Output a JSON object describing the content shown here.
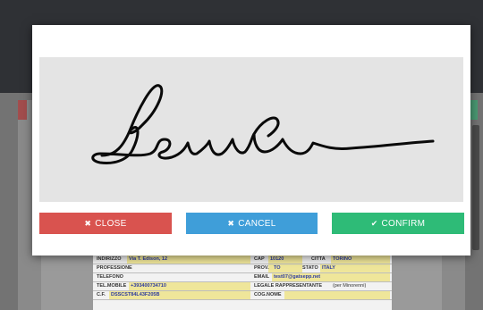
{
  "dialog": {
    "buttons": {
      "close_label": "CLOSE",
      "cancel_label": "CANCEL",
      "confirm_label": "CONFIRM"
    },
    "icons": {
      "close": "times-icon",
      "cancel": "times-icon",
      "confirm": "check-icon"
    },
    "colors": {
      "close": "#d9534f",
      "cancel": "#3f9ed9",
      "confirm": "#2ebb77",
      "canvas": "#e4e4e4"
    }
  },
  "form": {
    "row1": {
      "label": "INDIRIZZO",
      "value": "Via T. Edison, 12",
      "cap_label": "CAP",
      "cap_value": "10120",
      "citta_label": "CITTA",
      "citta_value": "TORINO"
    },
    "row2": {
      "label": "PROFESSIONE",
      "prov_label": "PROV.",
      "prov_value": "TO",
      "stato_label": "STATO",
      "stato_value": "ITALY"
    },
    "row3": {
      "label": "TELEFONO",
      "email_label": "EMAIL",
      "email_value": "test07@gatsepp.net"
    },
    "row4": {
      "label": "TEL.MOBILE",
      "value": "+393400734710",
      "legale_label": "LEGALE RAPPRESENTANTE",
      "legale_note": "(per Minorenni)"
    },
    "row5": {
      "label": "C.F.",
      "value": "DSSCST84L43F205B",
      "cognome_label": "COG.NOME"
    }
  }
}
